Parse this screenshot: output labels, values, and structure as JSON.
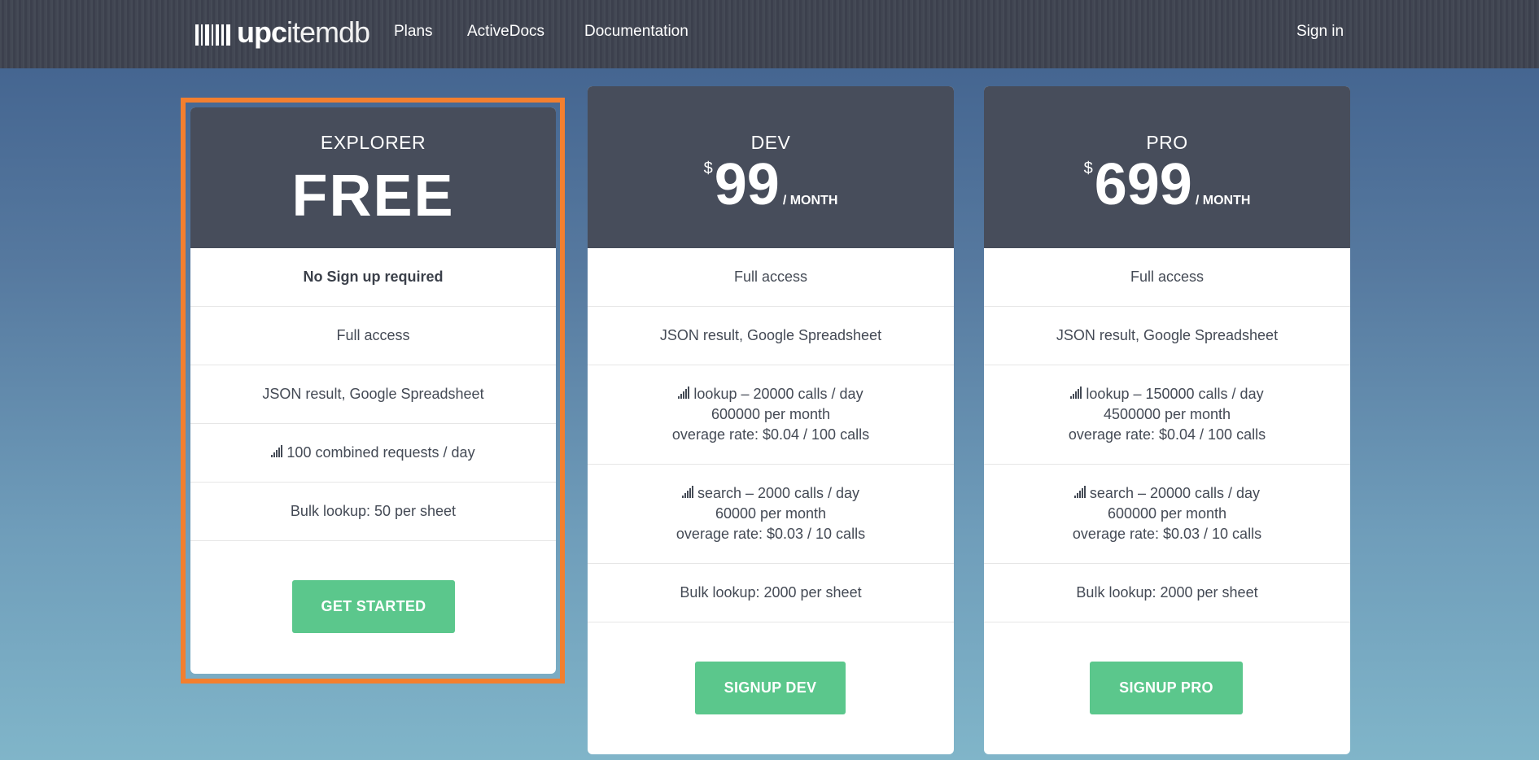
{
  "header": {
    "logo_bold": "upc",
    "logo_rest": "itemdb",
    "nav": [
      "Plans",
      "ActiveDocs",
      "Documentation"
    ],
    "signin": "Sign in"
  },
  "plans": {
    "explorer": {
      "name": "EXPLORER",
      "price": "FREE",
      "features": [
        "No Sign up required",
        "Full access",
        "JSON result, Google Spreadsheet",
        "100 combined requests / day",
        "Bulk lookup: 50 per sheet"
      ],
      "button": "GET STARTED"
    },
    "dev": {
      "name": "DEV",
      "currency": "$",
      "price": "99",
      "period": "/ MONTH",
      "full_access": "Full access",
      "json": "JSON result, Google Spreadsheet",
      "lookup": [
        "lookup – 20000 calls / day",
        "600000 per month",
        "overage rate: $0.04 / 100 calls"
      ],
      "search": [
        "search – 2000 calls / day",
        "60000 per month",
        "overage rate: $0.03 / 10 calls"
      ],
      "bulk": "Bulk lookup: 2000 per sheet",
      "button": "SIGNUP DEV"
    },
    "pro": {
      "name": "PRO",
      "currency": "$",
      "price": "699",
      "period": "/ MONTH",
      "full_access": "Full access",
      "json": "JSON result, Google Spreadsheet",
      "lookup": [
        "lookup – 150000 calls / day",
        "4500000 per month",
        "overage rate: $0.04 / 100 calls"
      ],
      "search": [
        "search – 20000 calls / day",
        "600000 per month",
        "overage rate: $0.03 / 10 calls"
      ],
      "bulk": "Bulk lookup: 2000 per sheet",
      "button": "SIGNUP PRO"
    }
  },
  "colors": {
    "header_bg": "#3e4350",
    "card_head": "#474d5b",
    "button": "#5bc78c",
    "highlight": "#f37f2f"
  },
  "icons": [
    "barcode-logo-icon",
    "signal-bars-icon"
  ]
}
